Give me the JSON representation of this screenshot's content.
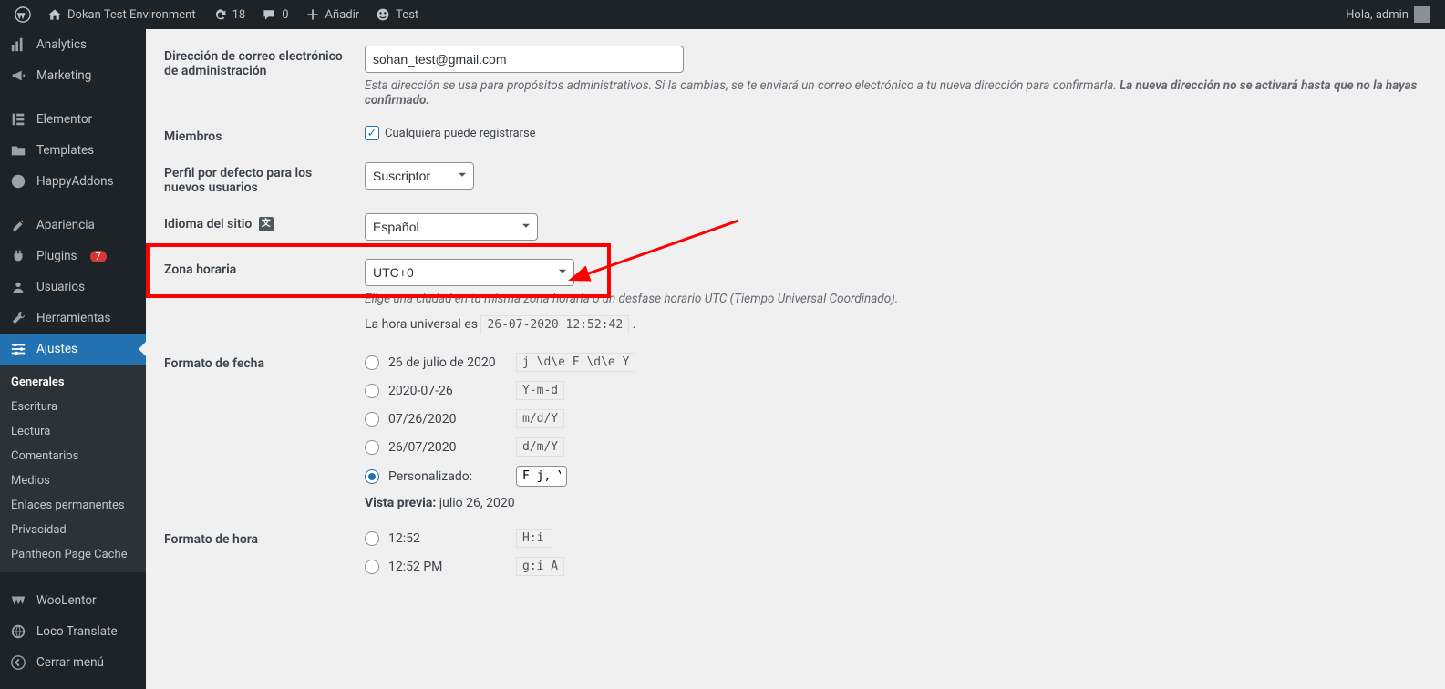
{
  "adminbar": {
    "site_name": "Dokan Test Environment",
    "updates_count": "18",
    "comments_count": "0",
    "add_label": "Añadir",
    "test_label": "Test",
    "greeting": "Hola, admin"
  },
  "sidebar": {
    "items": [
      {
        "label": "Analytics",
        "icon": "analytics"
      },
      {
        "label": "Marketing",
        "icon": "megaphone"
      },
      {
        "label": "Elementor",
        "icon": "elementor"
      },
      {
        "label": "Templates",
        "icon": "folder"
      },
      {
        "label": "HappyAddons",
        "icon": "happy"
      },
      {
        "label": "Apariencia",
        "icon": "brush"
      },
      {
        "label": "Plugins",
        "icon": "plug",
        "badge": "7"
      },
      {
        "label": "Usuarios",
        "icon": "users"
      },
      {
        "label": "Herramientas",
        "icon": "tools"
      },
      {
        "label": "Ajustes",
        "icon": "sliders",
        "active": true
      }
    ],
    "submenu": [
      {
        "label": "Generales",
        "current": true
      },
      {
        "label": "Escritura"
      },
      {
        "label": "Lectura"
      },
      {
        "label": "Comentarios"
      },
      {
        "label": "Medios"
      },
      {
        "label": "Enlaces permanentes"
      },
      {
        "label": "Privacidad"
      },
      {
        "label": "Pantheon Page Cache"
      }
    ],
    "bottom": [
      {
        "label": "WooLentor",
        "icon": "woolentor"
      },
      {
        "label": "Loco Translate",
        "icon": "loco"
      },
      {
        "label": "Cerrar menú",
        "icon": "collapse"
      }
    ]
  },
  "settings": {
    "admin_email_label": "Dirección de correo electrónico de administración",
    "admin_email_value": "sohan_test@gmail.com",
    "admin_email_desc_1": "Esta dirección se usa para propósitos administrativos. Si la cambias, se te enviará un correo electrónico a tu nueva dirección para confirmarla. ",
    "admin_email_desc_bold": "La nueva dirección no se activará hasta que no la hayas confirmado.",
    "members_label": "Miembros",
    "members_checkbox_label": "Cualquiera puede registrarse",
    "default_role_label": "Perfil por defecto para los nuevos usuarios",
    "default_role_value": "Suscriptor",
    "site_language_label": "Idioma del sitio",
    "site_language_value": "Español",
    "timezone_label": "Zona horaria",
    "timezone_value": "UTC+0",
    "timezone_desc": "Elige una ciudad en tu misma zona horaria o un desfase horario UTC (Tiempo Universal Coordinado).",
    "universal_time_prefix": "La hora universal es ",
    "universal_time_value": "26-07-2020 12:52:42",
    "universal_time_suffix": " .",
    "date_format_label": "Formato de fecha",
    "date_formats": [
      {
        "display": "26 de julio de 2020",
        "code": "j \\d\\e F \\d\\e Y"
      },
      {
        "display": "2020-07-26",
        "code": "Y-m-d"
      },
      {
        "display": "07/26/2020",
        "code": "m/d/Y"
      },
      {
        "display": "26/07/2020",
        "code": "d/m/Y"
      }
    ],
    "date_custom_label": "Personalizado:",
    "date_custom_value": "F j, Y",
    "date_preview_label": "Vista previa:",
    "date_preview_value": " julio 26, 2020",
    "time_format_label": "Formato de hora",
    "time_formats": [
      {
        "display": "12:52",
        "code": "H:i"
      },
      {
        "display": "12:52 PM",
        "code": "g:i A"
      }
    ]
  }
}
